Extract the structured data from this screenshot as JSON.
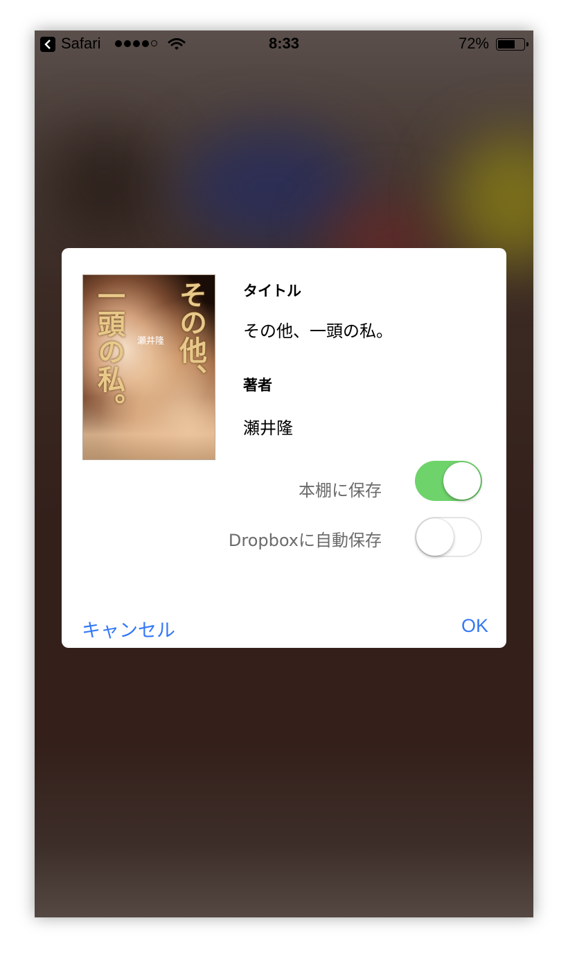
{
  "status_bar": {
    "back_app": "Safari",
    "time": "8:33",
    "battery_percent": "72%",
    "battery_level": 0.72,
    "signal_bars_filled": 4,
    "signal_bars_total": 5
  },
  "dialog": {
    "cover": {
      "title_vertical_right": "その他、",
      "title_vertical_left": "一頭の私。",
      "author_text": "瀬井隆"
    },
    "title_label": "タイトル",
    "title_value": "その他、一頭の私。",
    "author_label": "著者",
    "author_value": "瀬井隆",
    "toggles": [
      {
        "label": "本棚に保存",
        "on": true
      },
      {
        "label": "Dropboxに自動保存",
        "on": false
      }
    ],
    "cancel_label": "キャンセル",
    "ok_label": "OK"
  },
  "colors": {
    "accent": "#3478f6",
    "switch_on": "#6fd36c"
  }
}
